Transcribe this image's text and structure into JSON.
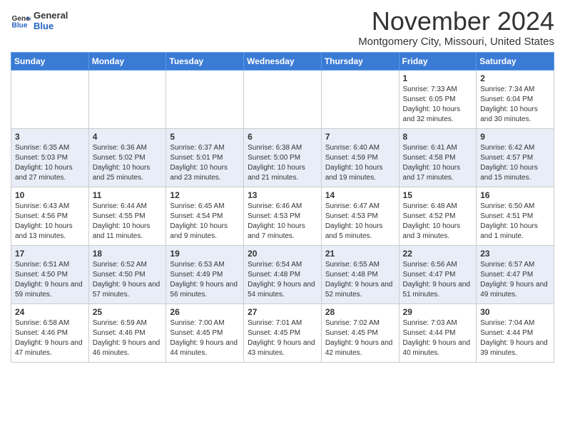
{
  "header": {
    "logo_general": "General",
    "logo_blue": "Blue",
    "month_title": "November 2024",
    "location": "Montgomery City, Missouri, United States"
  },
  "days_of_week": [
    "Sunday",
    "Monday",
    "Tuesday",
    "Wednesday",
    "Thursday",
    "Friday",
    "Saturday"
  ],
  "weeks": [
    [
      {
        "day": "",
        "info": ""
      },
      {
        "day": "",
        "info": ""
      },
      {
        "day": "",
        "info": ""
      },
      {
        "day": "",
        "info": ""
      },
      {
        "day": "",
        "info": ""
      },
      {
        "day": "1",
        "info": "Sunrise: 7:33 AM\nSunset: 6:05 PM\nDaylight: 10 hours and 32 minutes."
      },
      {
        "day": "2",
        "info": "Sunrise: 7:34 AM\nSunset: 6:04 PM\nDaylight: 10 hours and 30 minutes."
      }
    ],
    [
      {
        "day": "3",
        "info": "Sunrise: 6:35 AM\nSunset: 5:03 PM\nDaylight: 10 hours and 27 minutes."
      },
      {
        "day": "4",
        "info": "Sunrise: 6:36 AM\nSunset: 5:02 PM\nDaylight: 10 hours and 25 minutes."
      },
      {
        "day": "5",
        "info": "Sunrise: 6:37 AM\nSunset: 5:01 PM\nDaylight: 10 hours and 23 minutes."
      },
      {
        "day": "6",
        "info": "Sunrise: 6:38 AM\nSunset: 5:00 PM\nDaylight: 10 hours and 21 minutes."
      },
      {
        "day": "7",
        "info": "Sunrise: 6:40 AM\nSunset: 4:59 PM\nDaylight: 10 hours and 19 minutes."
      },
      {
        "day": "8",
        "info": "Sunrise: 6:41 AM\nSunset: 4:58 PM\nDaylight: 10 hours and 17 minutes."
      },
      {
        "day": "9",
        "info": "Sunrise: 6:42 AM\nSunset: 4:57 PM\nDaylight: 10 hours and 15 minutes."
      }
    ],
    [
      {
        "day": "10",
        "info": "Sunrise: 6:43 AM\nSunset: 4:56 PM\nDaylight: 10 hours and 13 minutes."
      },
      {
        "day": "11",
        "info": "Sunrise: 6:44 AM\nSunset: 4:55 PM\nDaylight: 10 hours and 11 minutes."
      },
      {
        "day": "12",
        "info": "Sunrise: 6:45 AM\nSunset: 4:54 PM\nDaylight: 10 hours and 9 minutes."
      },
      {
        "day": "13",
        "info": "Sunrise: 6:46 AM\nSunset: 4:53 PM\nDaylight: 10 hours and 7 minutes."
      },
      {
        "day": "14",
        "info": "Sunrise: 6:47 AM\nSunset: 4:53 PM\nDaylight: 10 hours and 5 minutes."
      },
      {
        "day": "15",
        "info": "Sunrise: 6:48 AM\nSunset: 4:52 PM\nDaylight: 10 hours and 3 minutes."
      },
      {
        "day": "16",
        "info": "Sunrise: 6:50 AM\nSunset: 4:51 PM\nDaylight: 10 hours and 1 minute."
      }
    ],
    [
      {
        "day": "17",
        "info": "Sunrise: 6:51 AM\nSunset: 4:50 PM\nDaylight: 9 hours and 59 minutes."
      },
      {
        "day": "18",
        "info": "Sunrise: 6:52 AM\nSunset: 4:50 PM\nDaylight: 9 hours and 57 minutes."
      },
      {
        "day": "19",
        "info": "Sunrise: 6:53 AM\nSunset: 4:49 PM\nDaylight: 9 hours and 56 minutes."
      },
      {
        "day": "20",
        "info": "Sunrise: 6:54 AM\nSunset: 4:48 PM\nDaylight: 9 hours and 54 minutes."
      },
      {
        "day": "21",
        "info": "Sunrise: 6:55 AM\nSunset: 4:48 PM\nDaylight: 9 hours and 52 minutes."
      },
      {
        "day": "22",
        "info": "Sunrise: 6:56 AM\nSunset: 4:47 PM\nDaylight: 9 hours and 51 minutes."
      },
      {
        "day": "23",
        "info": "Sunrise: 6:57 AM\nSunset: 4:47 PM\nDaylight: 9 hours and 49 minutes."
      }
    ],
    [
      {
        "day": "24",
        "info": "Sunrise: 6:58 AM\nSunset: 4:46 PM\nDaylight: 9 hours and 47 minutes."
      },
      {
        "day": "25",
        "info": "Sunrise: 6:59 AM\nSunset: 4:46 PM\nDaylight: 9 hours and 46 minutes."
      },
      {
        "day": "26",
        "info": "Sunrise: 7:00 AM\nSunset: 4:45 PM\nDaylight: 9 hours and 44 minutes."
      },
      {
        "day": "27",
        "info": "Sunrise: 7:01 AM\nSunset: 4:45 PM\nDaylight: 9 hours and 43 minutes."
      },
      {
        "day": "28",
        "info": "Sunrise: 7:02 AM\nSunset: 4:45 PM\nDaylight: 9 hours and 42 minutes."
      },
      {
        "day": "29",
        "info": "Sunrise: 7:03 AM\nSunset: 4:44 PM\nDaylight: 9 hours and 40 minutes."
      },
      {
        "day": "30",
        "info": "Sunrise: 7:04 AM\nSunset: 4:44 PM\nDaylight: 9 hours and 39 minutes."
      }
    ]
  ]
}
